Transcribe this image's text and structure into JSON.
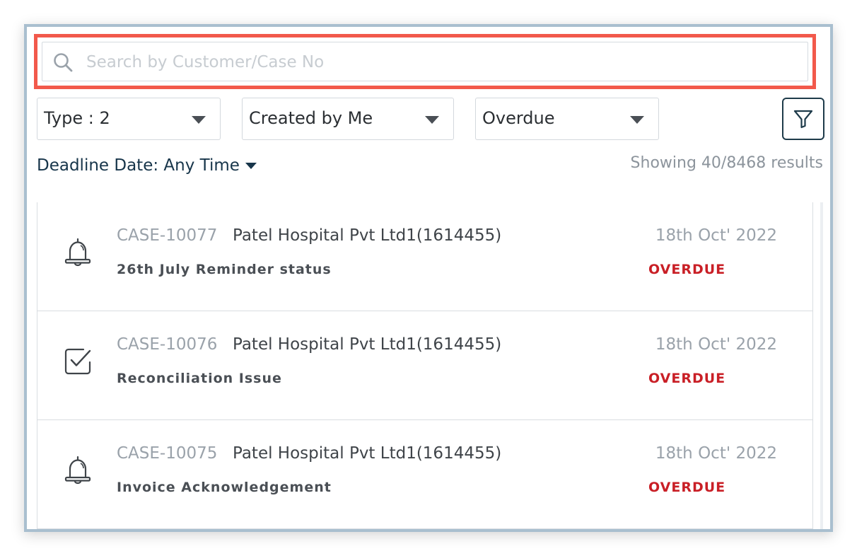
{
  "search": {
    "placeholder": "Search by Customer/Case No",
    "value": "",
    "icon": "search-icon",
    "highlight_color": "#f2594b"
  },
  "filters": {
    "type_label": "Type : 2",
    "created_label": "Created by Me",
    "status_label": "Overdue",
    "filter_icon": "funnel-icon"
  },
  "deadline": {
    "label": "Deadline Date: Any Time"
  },
  "results": {
    "text": "Showing 40/8468 results"
  },
  "cases": [
    {
      "case_no": "CASE-10077",
      "customer": "Patel Hospital Pvt Ltd1(1614455)",
      "subject": "26th July Reminder status",
      "date": "18th Oct' 2022",
      "status": "OVERDUE",
      "icon": "bell-icon"
    },
    {
      "case_no": "CASE-10076",
      "customer": "Patel Hospital Pvt Ltd1(1614455)",
      "subject": "Reconciliation Issue",
      "date": "18th Oct' 2022",
      "status": "OVERDUE",
      "icon": "task-check-icon"
    },
    {
      "case_no": "CASE-10075",
      "customer": "Patel Hospital Pvt Ltd1(1614455)",
      "subject": "Invoice Acknowledgement",
      "date": "18th Oct' 2022",
      "status": "OVERDUE",
      "icon": "bell-icon"
    }
  ],
  "colors": {
    "overdue": "#c91f26",
    "accent_dark": "#1e3b4a",
    "frame_border": "#a9bfcf"
  }
}
